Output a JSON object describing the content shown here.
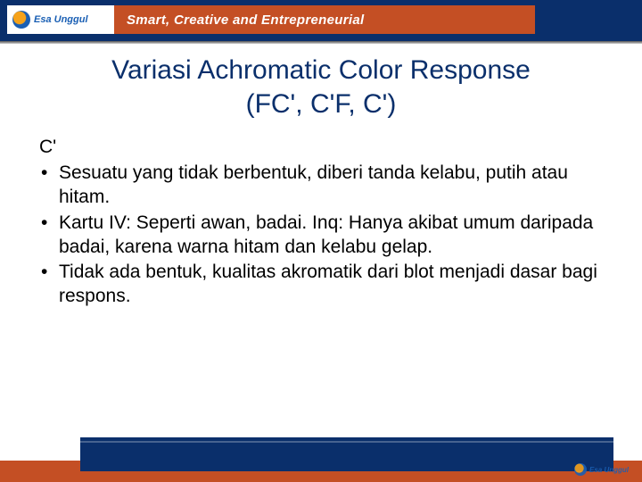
{
  "header": {
    "logo_text": "Esa Unggul",
    "tagline": "Smart, Creative and Entrepreneurial"
  },
  "title": {
    "line1": "Variasi Achromatic Color Response",
    "line2": "(FC', C'F, C')"
  },
  "content": {
    "section_label": "C'",
    "bullets": [
      "Sesuatu yang tidak berbentuk, diberi tanda kelabu, putih atau hitam.",
      "Kartu IV: Seperti awan, badai. Inq: Hanya akibat umum daripada badai, karena warna hitam dan kelabu gelap.",
      "Tidak ada bentuk, kualitas akromatik dari blot menjadi dasar bagi respons."
    ]
  },
  "footer": {
    "logo_text": "Esa Unggul"
  }
}
